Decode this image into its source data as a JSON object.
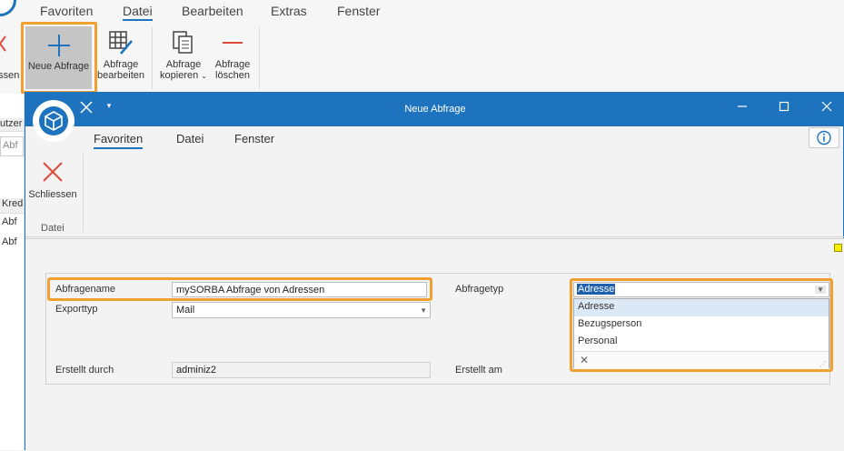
{
  "background_app": {
    "tabs": [
      "Favoriten",
      "Datei",
      "Bearbeiten",
      "Extras",
      "Fenster"
    ],
    "active_tab": "Datei",
    "ribbon": {
      "partial_left_label": "essen",
      "neue_abfrage": "Neue Abfrage",
      "abfrage_bearbeiten": [
        "Abfrage",
        "bearbeiten"
      ],
      "abfrage_kopieren": [
        "Abfrage",
        "kopieren"
      ],
      "abfrage_loeschen": [
        "Abfrage",
        "löschen"
      ]
    },
    "left_strip": {
      "col_header": "utzer",
      "field": "Abf",
      "table_header": "Kred",
      "rows": [
        "Abf",
        "Abf"
      ]
    }
  },
  "dialog": {
    "title": "Neue Abfrage",
    "tabs": [
      "Favoriten",
      "Datei",
      "Fenster"
    ],
    "active_tab": "Favoriten",
    "ribbon": {
      "close_label": "Schliessen",
      "group_label": "Datei"
    },
    "form": {
      "abfragename_label": "Abfragename",
      "abfragename_value": "mySORBA Abfrage von Adressen",
      "exporttyp_label": "Exporttyp",
      "exporttyp_value": "Mail",
      "erstellt_durch_label": "Erstellt durch",
      "erstellt_durch_value": "adminiz2",
      "abfragetyp_label": "Abfragetyp",
      "abfragetyp_value": "Adresse",
      "erstellt_am_label": "Erstellt am",
      "abfragetyp_options": [
        "Adresse",
        "Bezugsperson",
        "Personal"
      ]
    }
  },
  "colors": {
    "accent": "#1e73be",
    "highlight": "#f0a030",
    "close_red": "#e04a3a"
  }
}
